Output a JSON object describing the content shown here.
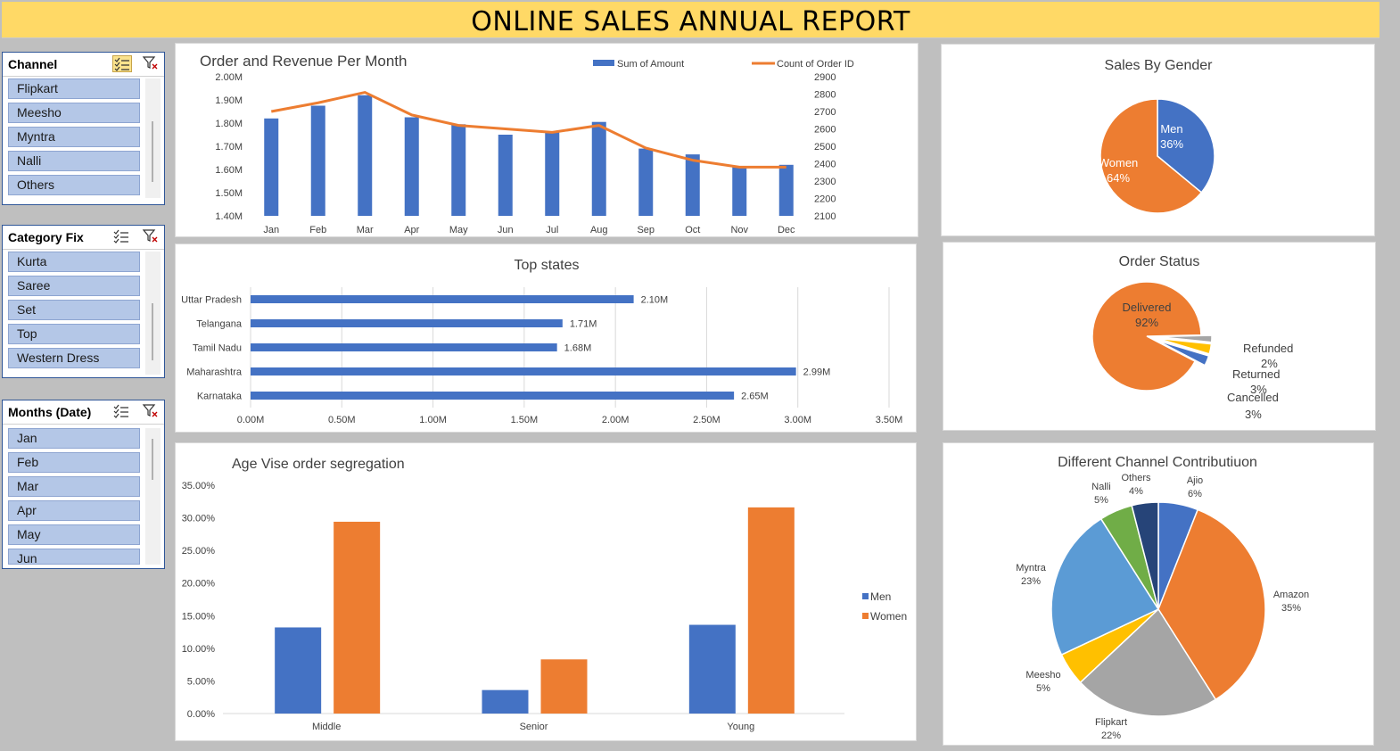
{
  "report_title": "ONLINE SALES ANNUAL REPORT",
  "slicers": [
    {
      "title": "Channel",
      "items": [
        "Flipkart",
        "Meesho",
        "Myntra",
        "Nalli",
        "Others"
      ],
      "multiselect_active": true
    },
    {
      "title": "Category Fix",
      "items": [
        "Kurta",
        "Saree",
        "Set",
        "Top",
        "Western Dress"
      ],
      "multiselect_active": false
    },
    {
      "title": "Months (Date)",
      "items": [
        "Jan",
        "Feb",
        "Mar",
        "Apr",
        "May",
        "Jun"
      ],
      "multiselect_active": false
    }
  ],
  "colors": {
    "blue": "#4472c4",
    "orange": "#ed7d31",
    "gray": "#a5a5a5",
    "yellow": "#ffc000",
    "lightblue": "#5b9bd5",
    "green": "#70ad47",
    "navy": "#264478",
    "banner": "#ffd966"
  },
  "chart_data": [
    {
      "type": "bar+line",
      "title": "Order and Revenue Per Month",
      "categories": [
        "Jan",
        "Feb",
        "Mar",
        "Apr",
        "May",
        "Jun",
        "Jul",
        "Aug",
        "Sep",
        "Oct",
        "Nov",
        "Dec"
      ],
      "series": [
        {
          "name": "Sum of Amount",
          "type": "bar",
          "axis": "left",
          "values": [
            1.82,
            1.875,
            1.92,
            1.825,
            1.795,
            1.75,
            1.765,
            1.805,
            1.69,
            1.665,
            1.61,
            1.62
          ]
        },
        {
          "name": "Count of Order ID",
          "type": "line",
          "axis": "right",
          "values": [
            2700,
            2750,
            2810,
            2680,
            2620,
            2600,
            2580,
            2620,
            2490,
            2420,
            2380,
            2380
          ]
        }
      ],
      "ylim_left": [
        1.4,
        2.0
      ],
      "ytick_left": [
        "1.40M",
        "1.50M",
        "1.60M",
        "1.70M",
        "1.80M",
        "1.90M",
        "2.00M"
      ],
      "ylim_right": [
        2100,
        2900
      ],
      "ytick_right": [
        "2100",
        "2200",
        "2300",
        "2400",
        "2500",
        "2600",
        "2700",
        "2800",
        "2900"
      ],
      "legend": "top-right"
    },
    {
      "type": "bar-horizontal",
      "title": "Top states",
      "categories": [
        "Uttar Pradesh",
        "Telangana",
        "Tamil Nadu",
        "Maharashtra",
        "Karnataka"
      ],
      "values": [
        2.1,
        1.71,
        1.68,
        2.99,
        2.65
      ],
      "data_labels": [
        "2.10M",
        "1.71M",
        "1.68M",
        "2.99M",
        "2.65M"
      ],
      "xlim": [
        0,
        3.5
      ],
      "xticks": [
        "0.00M",
        "0.50M",
        "1.00M",
        "1.50M",
        "2.00M",
        "2.50M",
        "3.00M",
        "3.50M"
      ],
      "grid": true
    },
    {
      "type": "bar",
      "title": "Age Vise order segregation",
      "categories": [
        "Middle",
        "Senior",
        "Young"
      ],
      "series": [
        {
          "name": "Men",
          "values": [
            13.2,
            3.6,
            13.6
          ]
        },
        {
          "name": "Women",
          "values": [
            29.4,
            8.3,
            31.6
          ]
        }
      ],
      "ylim": [
        0,
        35
      ],
      "yticks": [
        "0.00%",
        "5.00%",
        "10.00%",
        "15.00%",
        "20.00%",
        "25.00%",
        "30.00%",
        "35.00%"
      ],
      "legend": "right"
    },
    {
      "type": "pie",
      "title": "Sales By Gender",
      "slices": [
        {
          "label": "Men",
          "value": 36,
          "pct": "36%"
        },
        {
          "label": "Women",
          "value": 64,
          "pct": "64%"
        }
      ]
    },
    {
      "type": "pie",
      "title": "Order Status",
      "slices": [
        {
          "label": "Delivered",
          "value": 92,
          "pct": "92%"
        },
        {
          "label": "Refunded",
          "value": 2,
          "pct": "2%"
        },
        {
          "label": "Returned",
          "value": 3,
          "pct": "3%"
        },
        {
          "label": "Cancelled",
          "value": 3,
          "pct": "3%"
        }
      ]
    },
    {
      "type": "pie",
      "title": "Different Channel Contributiuon",
      "slices": [
        {
          "label": "Ajio",
          "value": 6,
          "pct": "6%"
        },
        {
          "label": "Amazon",
          "value": 35,
          "pct": "35%"
        },
        {
          "label": "Flipkart",
          "value": 22,
          "pct": "22%"
        },
        {
          "label": "Meesho",
          "value": 5,
          "pct": "5%"
        },
        {
          "label": "Myntra",
          "value": 23,
          "pct": "23%"
        },
        {
          "label": "Nalli",
          "value": 5,
          "pct": "5%"
        },
        {
          "label": "Others",
          "value": 4,
          "pct": "4%"
        }
      ]
    }
  ]
}
